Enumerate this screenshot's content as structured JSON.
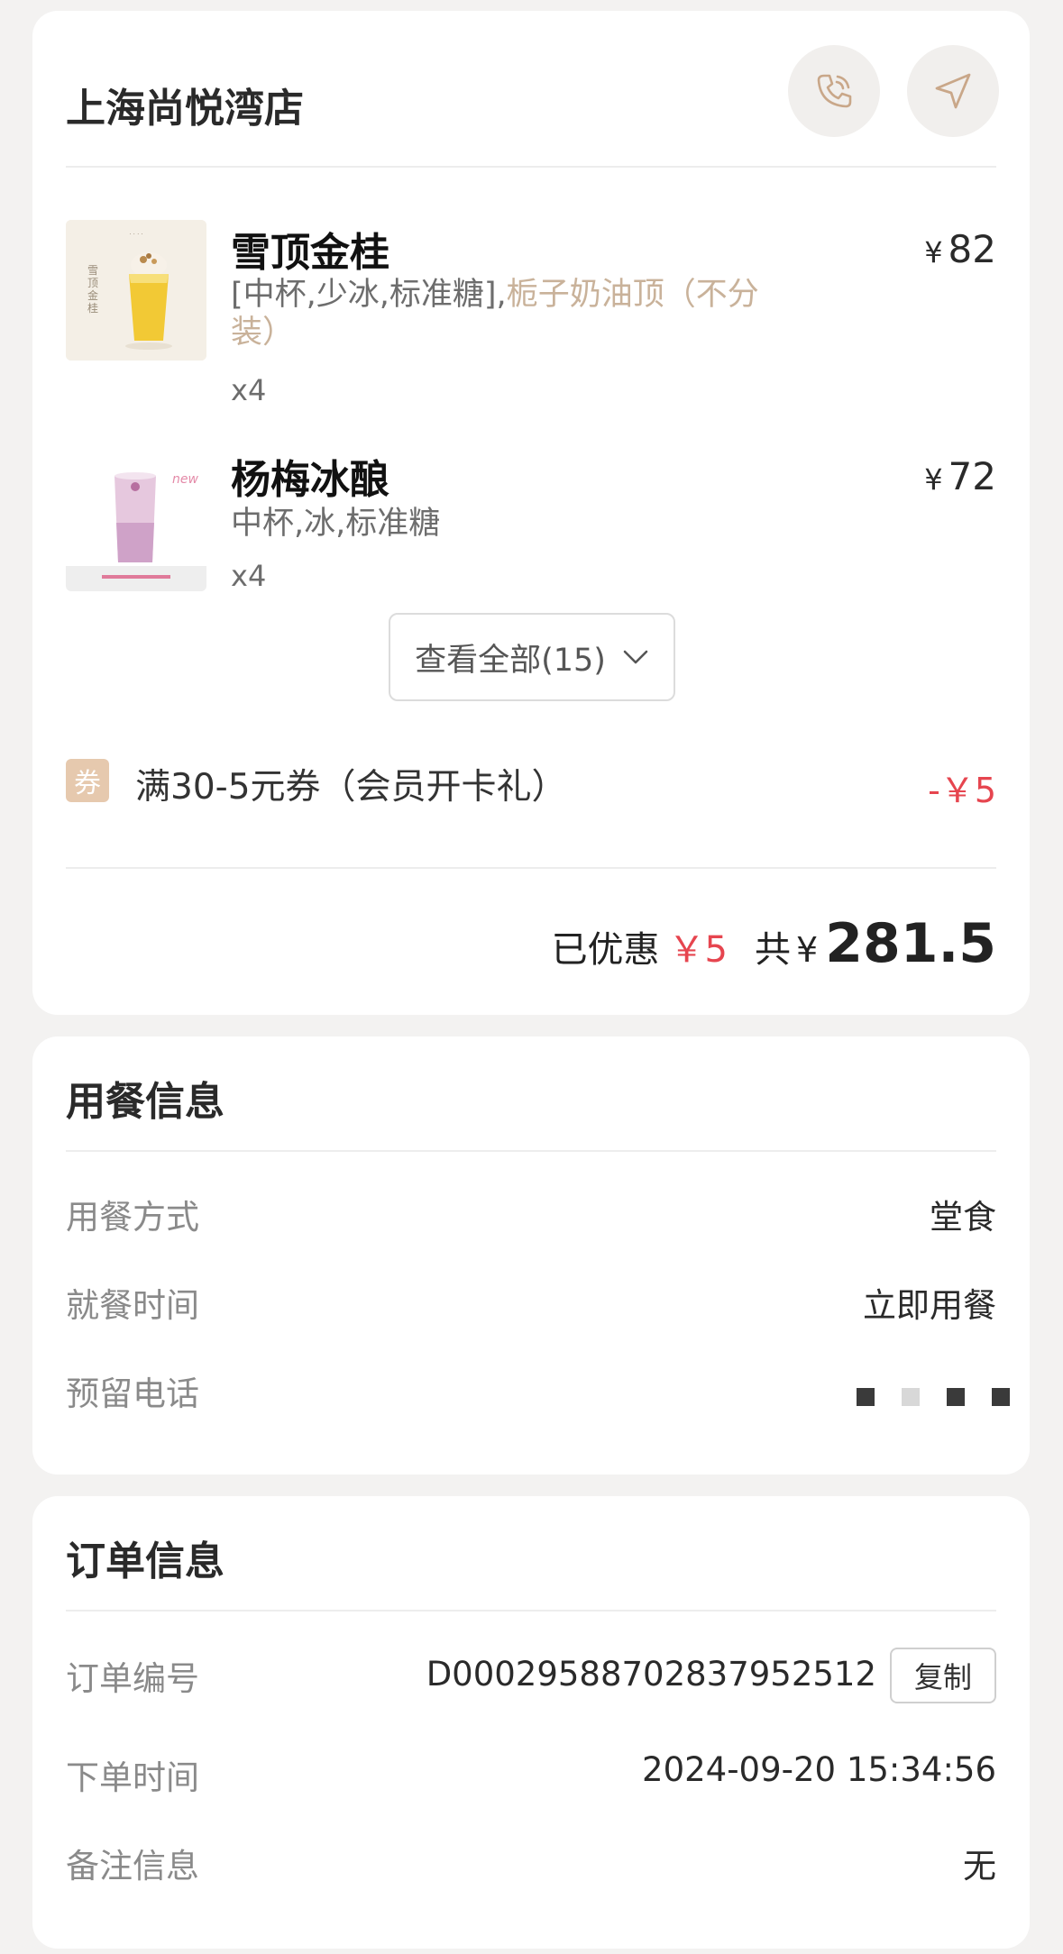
{
  "store": {
    "name": "上海尚悦湾店",
    "call_icon": "phone-call-icon",
    "nav_icon": "navigation-icon"
  },
  "items": [
    {
      "name": "雪顶金桂",
      "spec": "[中杯,少冰,标准糖],",
      "spec_extra": "栀子奶油顶（不分装）",
      "qty": "x4",
      "currency": "¥",
      "price": "82",
      "thumb_text": "雪顶金桂"
    },
    {
      "name": "杨梅冰酿",
      "spec": "中杯,冰,标准糖",
      "spec_extra": "",
      "qty": "x4",
      "currency": "¥",
      "price": "72",
      "thumb_text": "new"
    }
  ],
  "view_all": "查看全部(15)",
  "coupon": {
    "badge": "券",
    "text": "满30-5元券（会员开卡礼）",
    "amount": "-￥5"
  },
  "total": {
    "discount_label": "已优惠",
    "discount_value": "￥5",
    "total_label": "共",
    "currency": "¥",
    "amount": "281.5"
  },
  "dining": {
    "title": "用餐信息",
    "rows": [
      {
        "label": "用餐方式",
        "value": "堂食"
      },
      {
        "label": "就餐时间",
        "value": "立即用餐"
      },
      {
        "label": "预留电话",
        "value": ""
      }
    ]
  },
  "order": {
    "title": "订单信息",
    "rows": [
      {
        "label": "订单编号",
        "value": "D000295887028379525​12"
      },
      {
        "label": "下单时间",
        "value": "2024-09-20 15:34:56"
      },
      {
        "label": "备注信息",
        "value": "无"
      }
    ],
    "copy_label": "复制"
  },
  "colors": {
    "accent_red": "#e6454f",
    "spec_gold": "#c9b29a",
    "coupon_badge": "#e6c9ae"
  }
}
